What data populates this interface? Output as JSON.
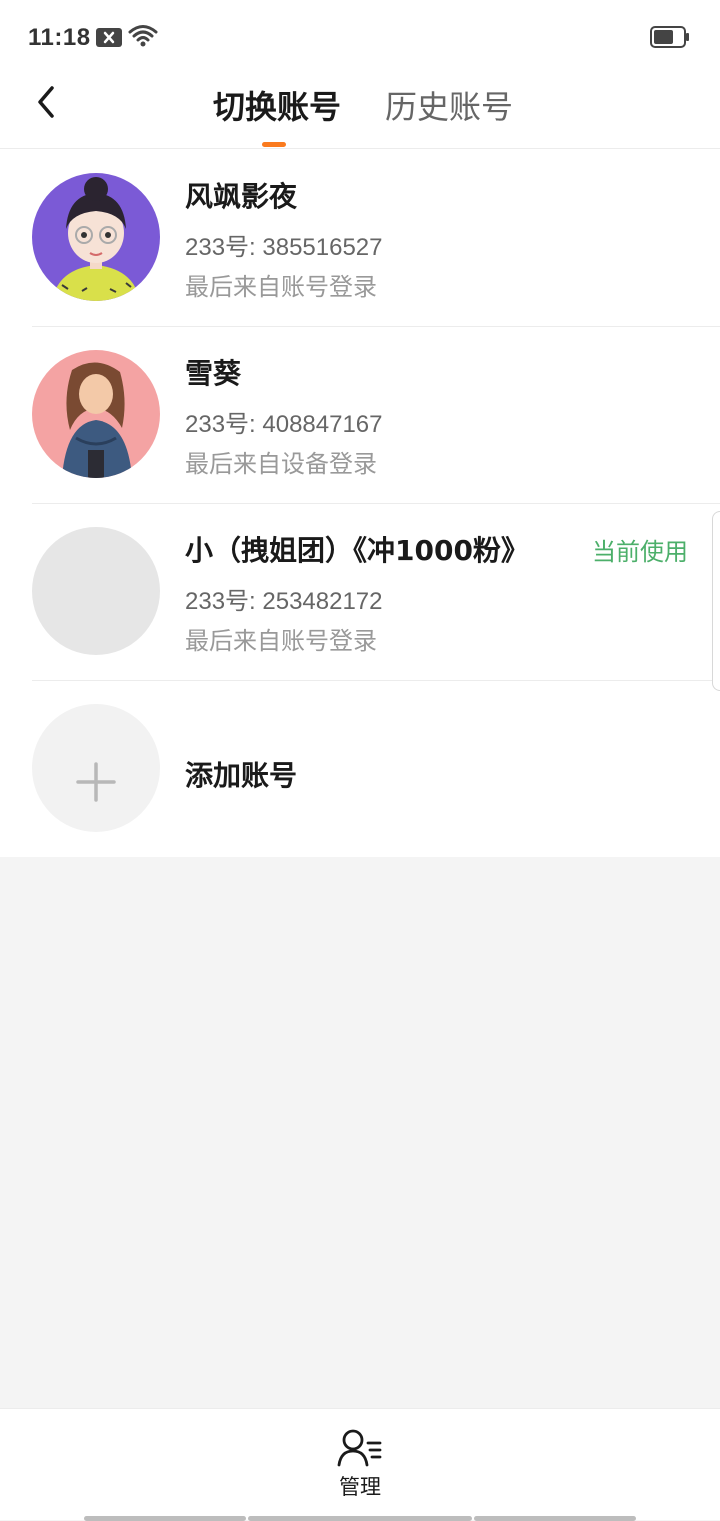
{
  "status_bar": {
    "time": "11:18"
  },
  "header": {
    "tabs": [
      {
        "label": "切换账号",
        "active": true
      },
      {
        "label": "历史账号",
        "active": false
      }
    ],
    "accent_color": "#fa7a1e"
  },
  "accounts": [
    {
      "name": "风飒影夜",
      "id_text": "233号: 385516527",
      "source": "最后来自账号登录",
      "current": false
    },
    {
      "name": "雪葵",
      "id_text": "233号: 408847167",
      "source": "最后来自设备登录",
      "current": false
    },
    {
      "name": "小（拽姐团）《冲1000粉》",
      "id_text": "233号: 253482172",
      "source": "最后来自账号登录",
      "current": true,
      "current_label": "当前使用"
    }
  ],
  "add_account": {
    "label": "添加账号",
    "icon": "plus-icon"
  },
  "bottom": {
    "manage_label": "管理",
    "icon": "user-manage-icon"
  },
  "colors": {
    "current_badge": "#4caf6a",
    "background": "#f4f4f4"
  }
}
